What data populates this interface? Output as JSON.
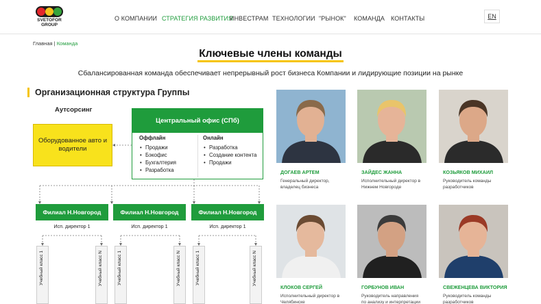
{
  "header": {
    "logo_line1": "SVETOFOR",
    "logo_line2": "GROUP",
    "nav": [
      {
        "label": "О КОМПАНИИ",
        "active": false
      },
      {
        "label": "СТРАТЕГИЯ РАЗВИТИЯ",
        "active": true
      },
      {
        "label": "ИНВЕСТРАМ",
        "active": false
      },
      {
        "label": "ТЕХНОЛОГИИ",
        "active": false
      },
      {
        "label": "\"РЫНОК\"",
        "active": false
      },
      {
        "label": "КОМАНДА",
        "active": false
      },
      {
        "label": "КОНТАКТЫ",
        "active": false
      }
    ],
    "lang": "EN"
  },
  "breadcrumb": {
    "home": "Главная",
    "separator": "|",
    "current": "Команда"
  },
  "page": {
    "title": "Ключевые члены команды",
    "subtitle": "Сбалансированная команда обеспечивает непрерывный рост бизнеса Компании и лидирующие позиции на рынке"
  },
  "org": {
    "title": "Организационная структура Группы",
    "outsourcing_label": "Аутсорсинг",
    "outsourcing_box": "Оборудованное авто и водители",
    "central_office": "Центральный офис (СПб)",
    "offline": {
      "title": "Оффлайн",
      "items": [
        "Продажи",
        "Бэкофис",
        "Бухгалтерия",
        "Разработка"
      ]
    },
    "online": {
      "title": "Онлайн",
      "items": [
        "Разработка",
        "Создание контента",
        "Продажи"
      ]
    },
    "branches": [
      {
        "name": "Филиал Н.Новгород",
        "director": "Исп. директор 1"
      },
      {
        "name": "Филиал Н.Новгород",
        "director": "Исп. директор 1"
      },
      {
        "name": "Филиал Н.Новгород",
        "director": "Исп. директор 1"
      }
    ],
    "classes": [
      "Учебный класс 1",
      "Учебный класс N"
    ]
  },
  "team": [
    {
      "name": "ДОГАЕВ АРТЕМ",
      "role": "Генеральный директор, владелец бизнеса",
      "bg": "#8fb4d0",
      "skin": "#e2b193",
      "hair": "#8a6a4a",
      "shirt": "#2d3441"
    },
    {
      "name": "ЗАЙДЕС ЖАННА",
      "role": "Исполнительный директор в Нижнем Новгороде",
      "bg": "#b9c9b0",
      "skin": "#e6b498",
      "hair": "#e9c46a",
      "shirt": "#2a2a2a"
    },
    {
      "name": "КОЗЬЯКОВ МИХАИЛ",
      "role": "Руководитель команды разработчиков",
      "bg": "#d9d4cc",
      "skin": "#dca888",
      "hair": "#4a3526",
      "shirt": "#2b2b2b"
    },
    {
      "name": "КЛОКОВ СЕРГЕЙ",
      "role": "Исполнительный директор в Челябинске",
      "bg": "#dfe3e6",
      "skin": "#e5b99d",
      "hair": "#6b4b33",
      "shirt": "#f0f0f0"
    },
    {
      "name": "ГОРБУНОВ ИВАН",
      "role": "Руководитель направления по анализу и интерпретации",
      "bg": "#bcbcbc",
      "skin": "#d3a183",
      "hair": "#3b3b3b",
      "shirt": "#202020"
    },
    {
      "name": "СВЕЖЕНЦЕВА ВИКТОРИЯ",
      "role": "Руководитель команды разработчиков",
      "bg": "#c9c4bd",
      "skin": "#e6b497",
      "hair": "#9b3a26",
      "shirt": "#1f3f6b"
    }
  ]
}
